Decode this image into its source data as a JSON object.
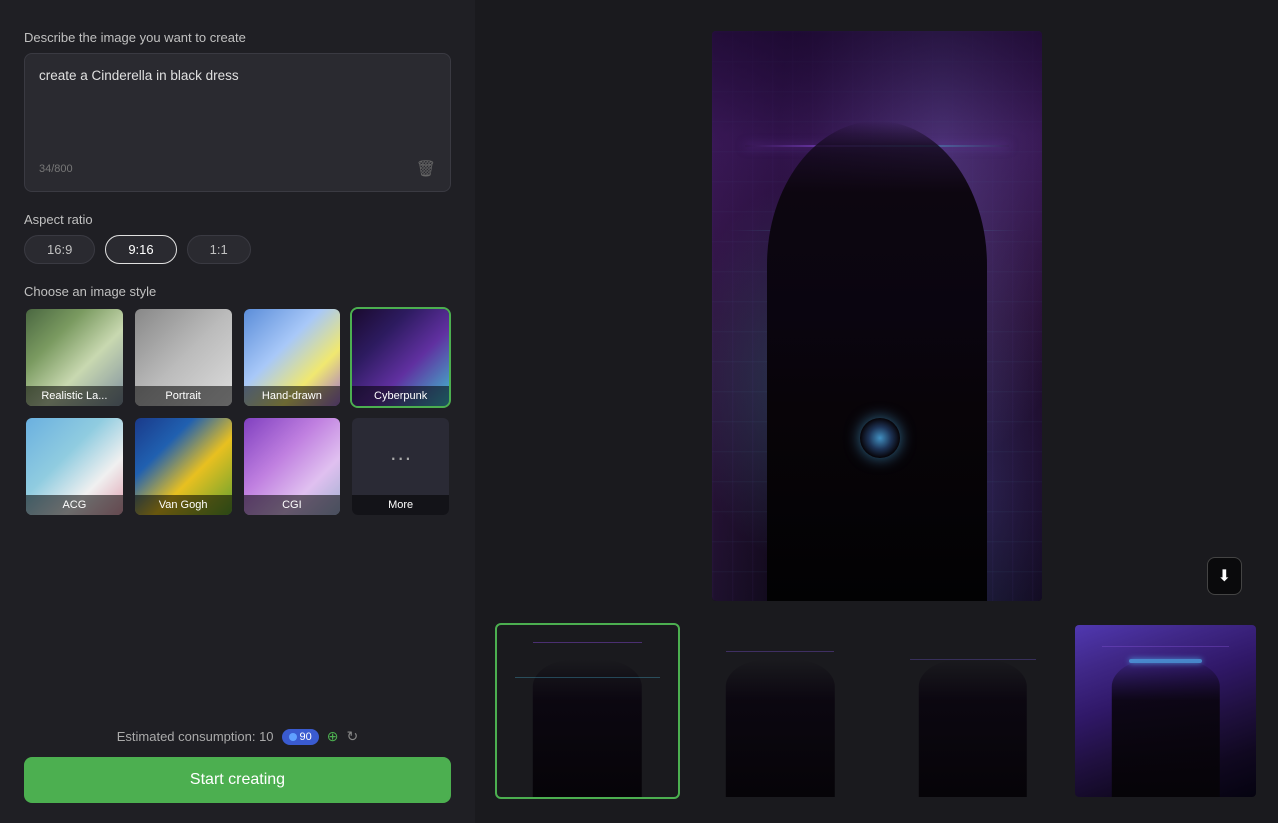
{
  "left_panel": {
    "prompt_label": "Describe the image you want to create",
    "prompt_value": "create a Cinderella in black dress",
    "char_count": "34/800",
    "aspect_ratio_label": "Aspect ratio",
    "aspect_options": [
      {
        "label": "16:9",
        "active": false
      },
      {
        "label": "9:16",
        "active": true
      },
      {
        "label": "1:1",
        "active": false
      }
    ],
    "style_label": "Choose an image style",
    "styles": [
      {
        "id": "realistic",
        "label": "Realistic La...",
        "selected": false
      },
      {
        "id": "portrait",
        "label": "Portrait",
        "selected": false
      },
      {
        "id": "handdrawn",
        "label": "Hand-drawn",
        "selected": false
      },
      {
        "id": "cyberpunk",
        "label": "Cyberpunk",
        "selected": true
      },
      {
        "id": "acg",
        "label": "ACG",
        "selected": false
      },
      {
        "id": "vangogh",
        "label": "Van Gogh",
        "selected": false
      },
      {
        "id": "cgi",
        "label": "CGI",
        "selected": false
      },
      {
        "id": "more",
        "label": "More",
        "selected": false
      }
    ],
    "consumption_text": "Estimated consumption: 10",
    "credits": "90",
    "start_button_label": "Start creating"
  },
  "icons": {
    "trash": "🗑",
    "download": "⬇",
    "refresh": "↻",
    "add": "⊕",
    "more_dots": "···"
  }
}
